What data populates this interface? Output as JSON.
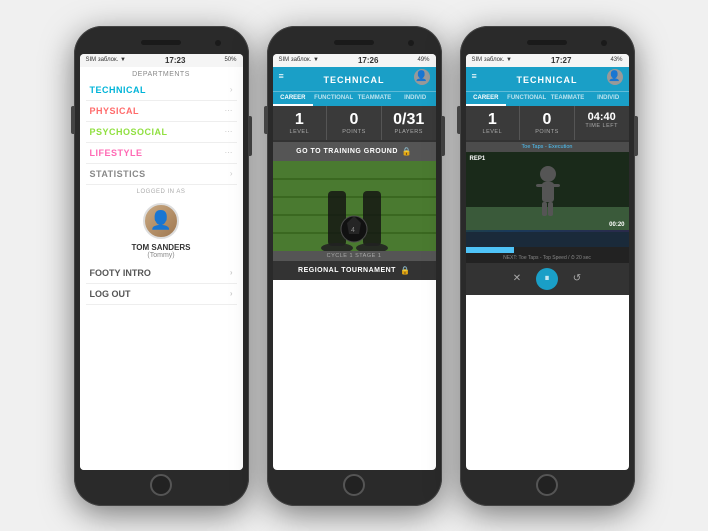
{
  "phones": [
    {
      "id": "phone-menu",
      "status": {
        "left": "SIM заблок. ▼",
        "time": "17:23",
        "right": "50%"
      },
      "menu": {
        "header": "DEPARTMENTS",
        "items": [
          {
            "label": "TECHNICAL",
            "color": "technical",
            "right": "chevron"
          },
          {
            "label": "PHYSICAL",
            "color": "physical",
            "right": "dots"
          },
          {
            "label": "PSYCHOSOCIAL",
            "color": "psychosocial",
            "right": "dots"
          },
          {
            "label": "LIFESTYLE",
            "color": "lifestyle",
            "right": "dots"
          },
          {
            "label": "STATISTICS",
            "color": "statistics",
            "right": "chevron"
          }
        ],
        "logged_as": "LOGGED IN AS",
        "user_name": "TOM SANDERS",
        "user_nick": "(Tommy)",
        "bottom_items": [
          {
            "label": "FOOTY INTRO",
            "right": "chevron"
          },
          {
            "label": "LOG OUT",
            "right": "chevron"
          }
        ]
      }
    },
    {
      "id": "phone-training",
      "status": {
        "left": "SIM заблок. ▼",
        "time": "17:26",
        "right": "49%"
      },
      "header": {
        "title": "TECHNICAL",
        "tabs": [
          "CAREER",
          "FUNCTIONAL",
          "TEAMMATE",
          "INDIVID"
        ]
      },
      "stats": [
        {
          "value": "1",
          "label": "LEVEL"
        },
        {
          "value": "0",
          "label": "POINTS"
        },
        {
          "value": "0/31",
          "label": "PLAYERS"
        }
      ],
      "training_btn": "GO TO TRAINING GROUND",
      "cycle": "CYCLE 1 STAGE 1",
      "tournament": "REGIONAL TOURNAMENT"
    },
    {
      "id": "phone-video",
      "status": {
        "left": "SIM заблок. ▼",
        "time": "17:27",
        "right": "43%"
      },
      "header": {
        "title": "TECHNICAL",
        "tabs": [
          "CAREER",
          "FUNCTIONAL",
          "TEAMMATE",
          "INDIVID"
        ]
      },
      "stats": [
        {
          "value": "1",
          "label": "LEVEL"
        },
        {
          "value": "0",
          "label": "POINTS"
        },
        {
          "value": "04:40",
          "label": "TIME LEFT"
        }
      ],
      "video": {
        "title": "Toe Taps - Execution",
        "rep": "REP1",
        "timer": "00:20",
        "next": "NEXT: Toe Taps - Top Speed  /  ⏱ 20 sec"
      },
      "controls": {
        "close": "✕",
        "play_pause": "⏸",
        "refresh": "↺"
      }
    }
  ]
}
